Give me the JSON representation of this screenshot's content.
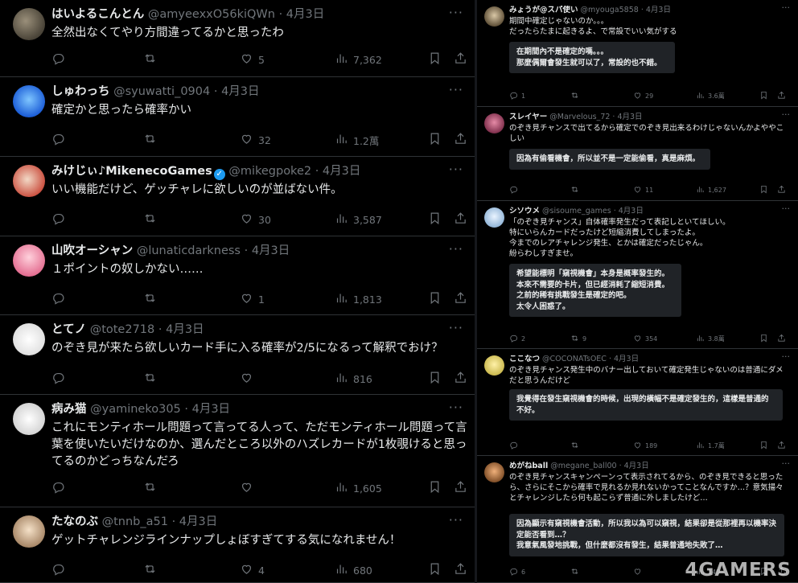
{
  "left_tweets": [
    {
      "name": "はいよるこんとん",
      "handle": "@amyeexxO56kiQWn",
      "date": "4月3日",
      "text": "全然出なくてやり方間違ってるかと思ったわ",
      "replies": "",
      "retweets": "",
      "likes": "5",
      "views": "7,362"
    },
    {
      "name": "しゅわっち",
      "handle": "@syuwatti_0904",
      "date": "4月3日",
      "text": "確定かと思ったら確率かい",
      "replies": "",
      "retweets": "",
      "likes": "32",
      "views": "1.2萬"
    },
    {
      "name": "みけじぃ♪MikenecoGames",
      "handle": "@mikegpoke2",
      "date": "4月3日",
      "verified": true,
      "text": "いい機能だけど、ゲッチャレに欲しいのが並ばない件。",
      "replies": "",
      "retweets": "",
      "likes": "30",
      "views": "3,587"
    },
    {
      "name": "山吹オーシャン",
      "handle": "@lunaticdarkness",
      "date": "4月3日",
      "text": "１ポイントの奴しかない……",
      "replies": "",
      "retweets": "",
      "likes": "1",
      "views": "1,813"
    },
    {
      "name": "とてノ",
      "handle": "@tote2718",
      "date": "4月3日",
      "text": "のぞき見が来たら欲しいカード手に入る確率が2/5になるって解釈でおけ？",
      "replies": "",
      "retweets": "",
      "likes": "",
      "views": "816"
    },
    {
      "name": "病み猫",
      "handle": "@yamineko305",
      "date": "4月3日",
      "text": "これにモンティホール問題って言ってる人って、ただモンティホール問題って言葉を使いたいだけなのか、選んだところ以外のハズレカードが1枚覗けると思ってるのかどっちなんだろ",
      "replies": "",
      "retweets": "",
      "likes": "",
      "views": "1,605"
    },
    {
      "name": "たなのぶ",
      "handle": "@tnnb_a51",
      "date": "4月3日",
      "text": "ゲットチャレンジラインナップしょぼすぎてする気になれません！",
      "replies": "",
      "retweets": "",
      "likes": "4",
      "views": "680"
    }
  ],
  "right_tweets": [
    {
      "name": "みょうが@スパ使い",
      "handle": "@myouga5858",
      "date": "4月3日",
      "text": "期間中確定じゃないのか。。。\nだったらたまに起きるよ、で常設でいい気がする",
      "translation": "在期間內不是確定的嗎。。。\n那麼偶爾會發生就可以了，常設的也不錯。",
      "replies": "1",
      "retweets": "",
      "likes": "29",
      "views": "3.6萬"
    },
    {
      "name": "スレイヤー",
      "handle": "@Marvelous_72",
      "date": "4月3日",
      "text": "のぞき見チャンスで出てるから確定でのぞき見出来るわけじゃないんかよややこしい",
      "translation": "因為有偷看機會，所以並不是一定能偷看，真是麻煩。",
      "replies": "",
      "retweets": "",
      "likes": "11",
      "views": "1,627"
    },
    {
      "name": "シソウメ",
      "handle": "@sisoume_games",
      "date": "4月3日",
      "text": "「のぞき見チャンス」自体確率発生だって表記しといてほしい。\n特にいらんカードだったけど短縮消費してしまったよ。\n今までのレアチャレンジ発生、とかは確定だったじゃん。\n紛らわしすぎませ。",
      "translation": "希望能標明「窺視機會」本身是概率發生的。\n本來不需要的卡片，但已經消耗了縮短消費。\n之前的稀有挑戰發生是確定的吧。\n太令人困惑了。",
      "replies": "2",
      "retweets": "9",
      "likes": "354",
      "views": "3.8萬"
    },
    {
      "name": "ここなつ",
      "handle": "@COCONATsOEC",
      "date": "4月3日",
      "text": "のぞき見チャンス発生中のバナー出しておいて確定発生じゃないのは普通にダメだと思うんだけど",
      "translation": "我覺得在發生窺視機會的時候，出現的橫幅不是確定發生的，這樣是普通的不好。",
      "replies": "",
      "retweets": "",
      "likes": "189",
      "views": "1.7萬"
    },
    {
      "name": "めがねball",
      "handle": "@megane_ball00",
      "date": "4月3日",
      "text": "のぞき見チャンスキャンペーンって表示されてるから、のぞき見できると思ったら、さらにそこから確率で見れるか見れないかってことなんですか…？意気揚々とチャレンジしたら何も起こらず普通に外しましたけど…",
      "translation": "因為顯示有窺視機會活動，所以我以為可以窺視，結果卻是從那裡再以機率決定能否看到…？\n我意氣風發地挑戰，但什麼都沒有發生，結果普通地失敗了…",
      "replies": "6",
      "retweets": "",
      "likes": "",
      "views": "149"
    }
  ],
  "watermark": "4GAMERS",
  "icons": {
    "reply": "reply-icon",
    "retweet": "retweet-icon",
    "like": "like-icon",
    "views": "views-icon",
    "bookmark": "bookmark-icon",
    "share": "share-icon",
    "more": "more-icon"
  }
}
